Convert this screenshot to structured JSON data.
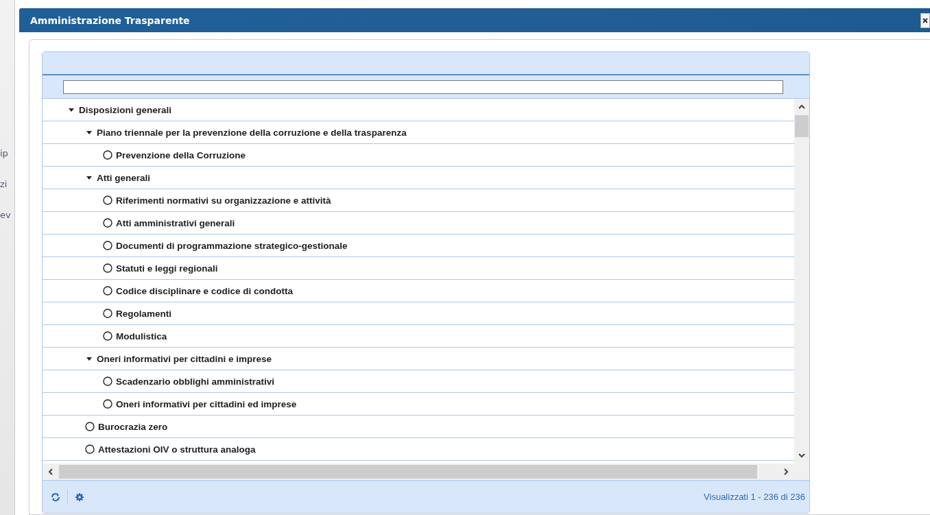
{
  "background_window": {
    "fragments": [
      "ip",
      "zi",
      "ev"
    ]
  },
  "window": {
    "title": "Amministrazione Trasparente"
  },
  "tree": [
    {
      "label": "Disposizioni generali",
      "expanded": true,
      "children": [
        {
          "label": "Piano triennale per la prevenzione della corruzione e della trasparenza",
          "expanded": true,
          "children": [
            {
              "label": "Prevenzione della Corruzione"
            }
          ]
        },
        {
          "label": "Atti generali",
          "expanded": true,
          "children": [
            {
              "label": "Riferimenti normativi su organizzazione e attività"
            },
            {
              "label": "Atti amministrativi generali"
            },
            {
              "label": "Documenti di programmazione strategico-gestionale"
            },
            {
              "label": "Statuti e leggi regionali"
            },
            {
              "label": "Codice disciplinare e codice di condotta"
            },
            {
              "label": "Regolamenti"
            },
            {
              "label": "Modulistica"
            }
          ]
        },
        {
          "label": "Oneri informativi per cittadini e imprese",
          "expanded": true,
          "children": [
            {
              "label": "Scadenzario obblighi amministrativi"
            },
            {
              "label": "Oneri informativi per cittadini ed imprese"
            }
          ]
        },
        {
          "label": "Burocrazia zero"
        },
        {
          "label": "Attestazioni OIV o struttura analoga"
        }
      ]
    }
  ],
  "status_bar": {
    "text": "Visualizzati 1 - 236 di 236"
  }
}
